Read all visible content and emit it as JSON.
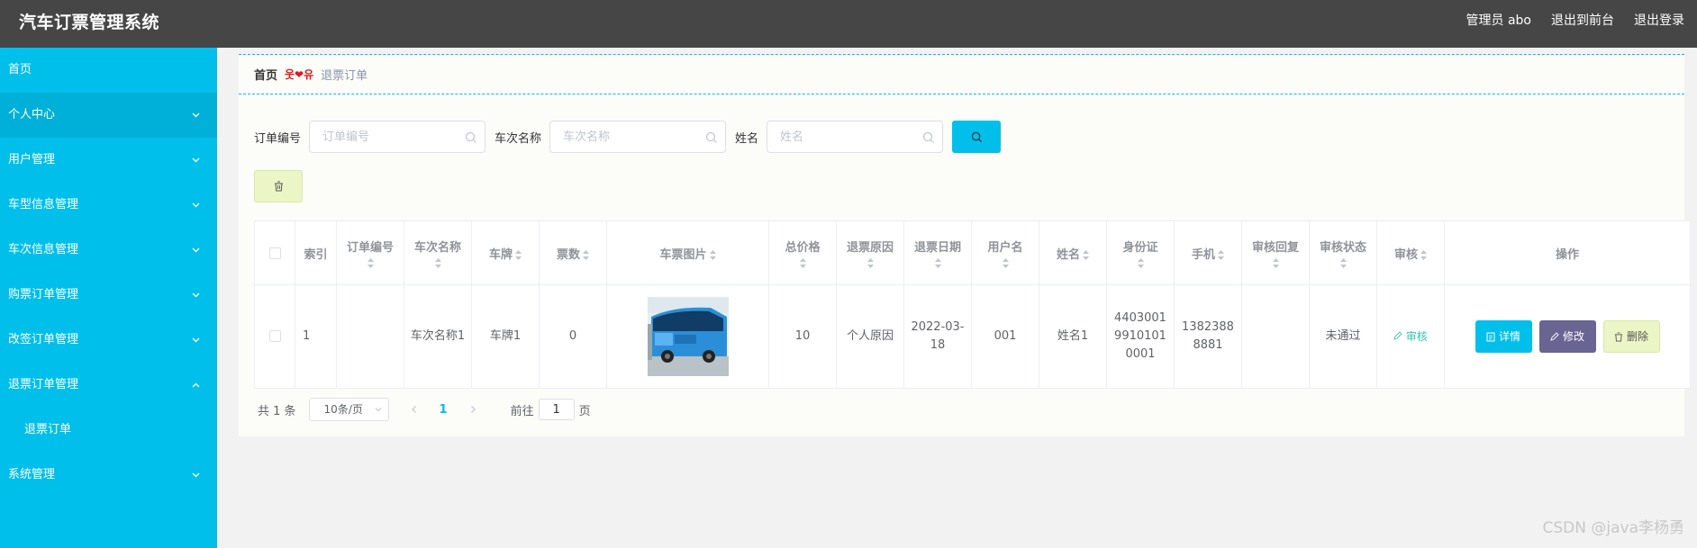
{
  "app": {
    "title": "汽车订票管理系统"
  },
  "header": {
    "user_label": "管理员 abo",
    "front_label": "退出到前台",
    "logout_label": "退出登录"
  },
  "sidebar": {
    "items": [
      {
        "label": "首页",
        "icon": "none",
        "expanded": false
      },
      {
        "label": "个人中心",
        "icon": "chevron-down-icon",
        "expanded": false
      },
      {
        "label": "用户管理",
        "icon": "chevron-down-icon",
        "expanded": false
      },
      {
        "label": "车型信息管理",
        "icon": "chevron-down-icon",
        "expanded": false
      },
      {
        "label": "车次信息管理",
        "icon": "chevron-down-icon",
        "expanded": false
      },
      {
        "label": "购票订单管理",
        "icon": "chevron-down-icon",
        "expanded": false
      },
      {
        "label": "改签订单管理",
        "icon": "chevron-down-icon",
        "expanded": false
      },
      {
        "label": "退票订单管理",
        "icon": "chevron-up-icon",
        "expanded": true
      },
      {
        "label": "系统管理",
        "icon": "chevron-down-icon",
        "expanded": false
      }
    ],
    "submenu": {
      "label": "退票订单"
    }
  },
  "breadcrumb": {
    "home": "首页",
    "separator": "웃❤유",
    "current": "退票订单"
  },
  "search": {
    "order_no_label": "订单编号",
    "order_no_placeholder": "订单编号",
    "trip_label": "车次名称",
    "trip_placeholder": "车次名称",
    "name_label": "姓名",
    "name_placeholder": "姓名"
  },
  "table": {
    "headers": {
      "index": "索引",
      "order_no": "订单编号",
      "trip_name": "车次名称",
      "plate": "车牌",
      "tickets": "票数",
      "image": "车票图片",
      "total_price": "总价格",
      "reason": "退票原因",
      "date": "退票日期",
      "username": "用户名",
      "name": "姓名",
      "id_card": "身份证",
      "phone": "手机",
      "reply": "审核回复",
      "status": "审核状态",
      "audit": "审核",
      "ops": "操作"
    },
    "rows": [
      {
        "index": "1",
        "order_no": "",
        "trip_name": "车次名称1",
        "plate": "车牌1",
        "tickets": "0",
        "total_price": "10",
        "reason": "个人原因",
        "date": "2022-03-18",
        "username": "001",
        "name": "姓名1",
        "id_card": "440300199101010001",
        "phone": "13823888881",
        "reply": "",
        "status": "未通过",
        "audit_label": "审核",
        "detail_label": "详情",
        "edit_label": "修改",
        "delete_label": "删除"
      }
    ]
  },
  "pagination": {
    "total_label": "共 1 条",
    "page_size_label": "10条/页",
    "current_page": "1",
    "goto_label": "前往",
    "goto_value": "1",
    "page_suffix": "页"
  },
  "watermark": "CSDN @java李杨勇",
  "colors": {
    "header_bg": "#464646",
    "sidebar_bg": "#00bfea",
    "accent": "#00bfea",
    "edit_button": "#6a6492",
    "delete_button": "#ecf5c5",
    "audit_link": "#2ecbb0"
  }
}
